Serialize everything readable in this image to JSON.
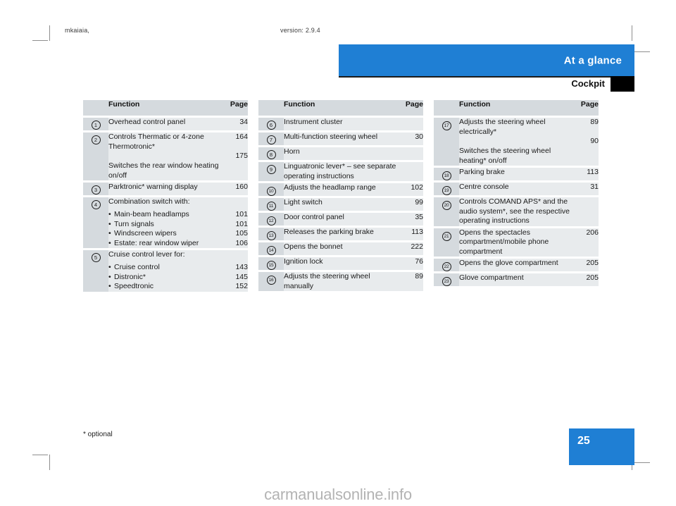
{
  "document": {
    "running_head_left": "mkaiaia,",
    "running_head_right": "version: 2.9.4",
    "banner_title": "At a glance",
    "section_title": "Cockpit",
    "footnote": "* optional",
    "page_number": "25",
    "watermark": "carmanualsonline.info",
    "accent_color": "#1f7fd4",
    "header_cell_color": "#d5dade",
    "body_cell_color": "#e8ebed"
  },
  "columns": [
    {
      "header": {
        "function": "Function",
        "page": "Page"
      },
      "rows": [
        {
          "num": "1",
          "lines": [
            {
              "text": "Overhead control panel",
              "page": "34"
            }
          ]
        },
        {
          "num": "2",
          "lines": [
            {
              "text": "Controls Thermatic or 4-zone Thermotronic*",
              "page": "164"
            },
            {
              "text": "Switches the rear window heating on/off",
              "page": "175",
              "gap": true
            }
          ]
        },
        {
          "num": "3",
          "lines": [
            {
              "text": "Parktronic* warning display",
              "page": "160"
            }
          ]
        },
        {
          "num": "4",
          "lines": [
            {
              "text": "Combination switch with:",
              "page": ""
            },
            {
              "text": "Main-beam headlamps",
              "page": "101",
              "bullet": true
            },
            {
              "text": "Turn signals",
              "page": "101",
              "bullet": true
            },
            {
              "text": "Windscreen wipers",
              "page": "105",
              "bullet": true
            },
            {
              "text": "Estate: rear window wiper",
              "page": "106",
              "bullet": true
            }
          ]
        },
        {
          "num": "5",
          "lines": [
            {
              "text": "Cruise control lever for:",
              "page": ""
            },
            {
              "text": "Cruise control",
              "page": "143",
              "bullet": true
            },
            {
              "text": "Distronic*",
              "page": "145",
              "bullet": true
            },
            {
              "text": "Speedtronic",
              "page": "152",
              "bullet": true
            }
          ]
        }
      ]
    },
    {
      "header": {
        "function": "Function",
        "page": "Page"
      },
      "rows": [
        {
          "num": "6",
          "lines": [
            {
              "text": "Instrument cluster",
              "page": ""
            }
          ]
        },
        {
          "num": "7",
          "lines": [
            {
              "text": "Multi-function steering wheel",
              "page": "30"
            }
          ]
        },
        {
          "num": "8",
          "lines": [
            {
              "text": "Horn",
              "page": ""
            }
          ]
        },
        {
          "num": "9",
          "lines": [
            {
              "text": "Linguatronic lever* – see separate operating instructions",
              "page": ""
            }
          ]
        },
        {
          "num": "10",
          "lines": [
            {
              "text": "Adjusts the headlamp range",
              "page": "102"
            }
          ]
        },
        {
          "num": "11",
          "lines": [
            {
              "text": "Light switch",
              "page": "99"
            }
          ]
        },
        {
          "num": "12",
          "lines": [
            {
              "text": "Door control panel",
              "page": "35"
            }
          ]
        },
        {
          "num": "13",
          "lines": [
            {
              "text": "Releases the parking brake",
              "page": "113"
            }
          ]
        },
        {
          "num": "14",
          "lines": [
            {
              "text": "Opens the bonnet",
              "page": "222"
            }
          ]
        },
        {
          "num": "15",
          "lines": [
            {
              "text": "Ignition lock",
              "page": "76"
            }
          ]
        },
        {
          "num": "16",
          "lines": [
            {
              "text": "Adjusts the steering wheel manually",
              "page": "89"
            }
          ]
        }
      ]
    },
    {
      "header": {
        "function": "Function",
        "page": "Page"
      },
      "rows": [
        {
          "num": "17",
          "lines": [
            {
              "text": "Adjusts the steering wheel electrically*",
              "page": "89"
            },
            {
              "text": "Switches the steering wheel heating* on/off",
              "page": "90",
              "gap": true
            }
          ]
        },
        {
          "num": "18",
          "lines": [
            {
              "text": "Parking brake",
              "page": "113"
            }
          ]
        },
        {
          "num": "19",
          "lines": [
            {
              "text": "Centre console",
              "page": "31"
            }
          ]
        },
        {
          "num": "20",
          "lines": [
            {
              "text": "Controls COMAND APS* and the audio system*, see the respective operating instructions",
              "page": ""
            }
          ]
        },
        {
          "num": "21",
          "lines": [
            {
              "text": "Opens the spectacles compartment/mobile phone compartment",
              "page": "206"
            }
          ]
        },
        {
          "num": "22",
          "lines": [
            {
              "text": "Opens the glove compartment",
              "page": "205"
            }
          ]
        },
        {
          "num": "23",
          "lines": [
            {
              "text": "Glove compartment",
              "page": "205"
            }
          ]
        }
      ]
    }
  ]
}
